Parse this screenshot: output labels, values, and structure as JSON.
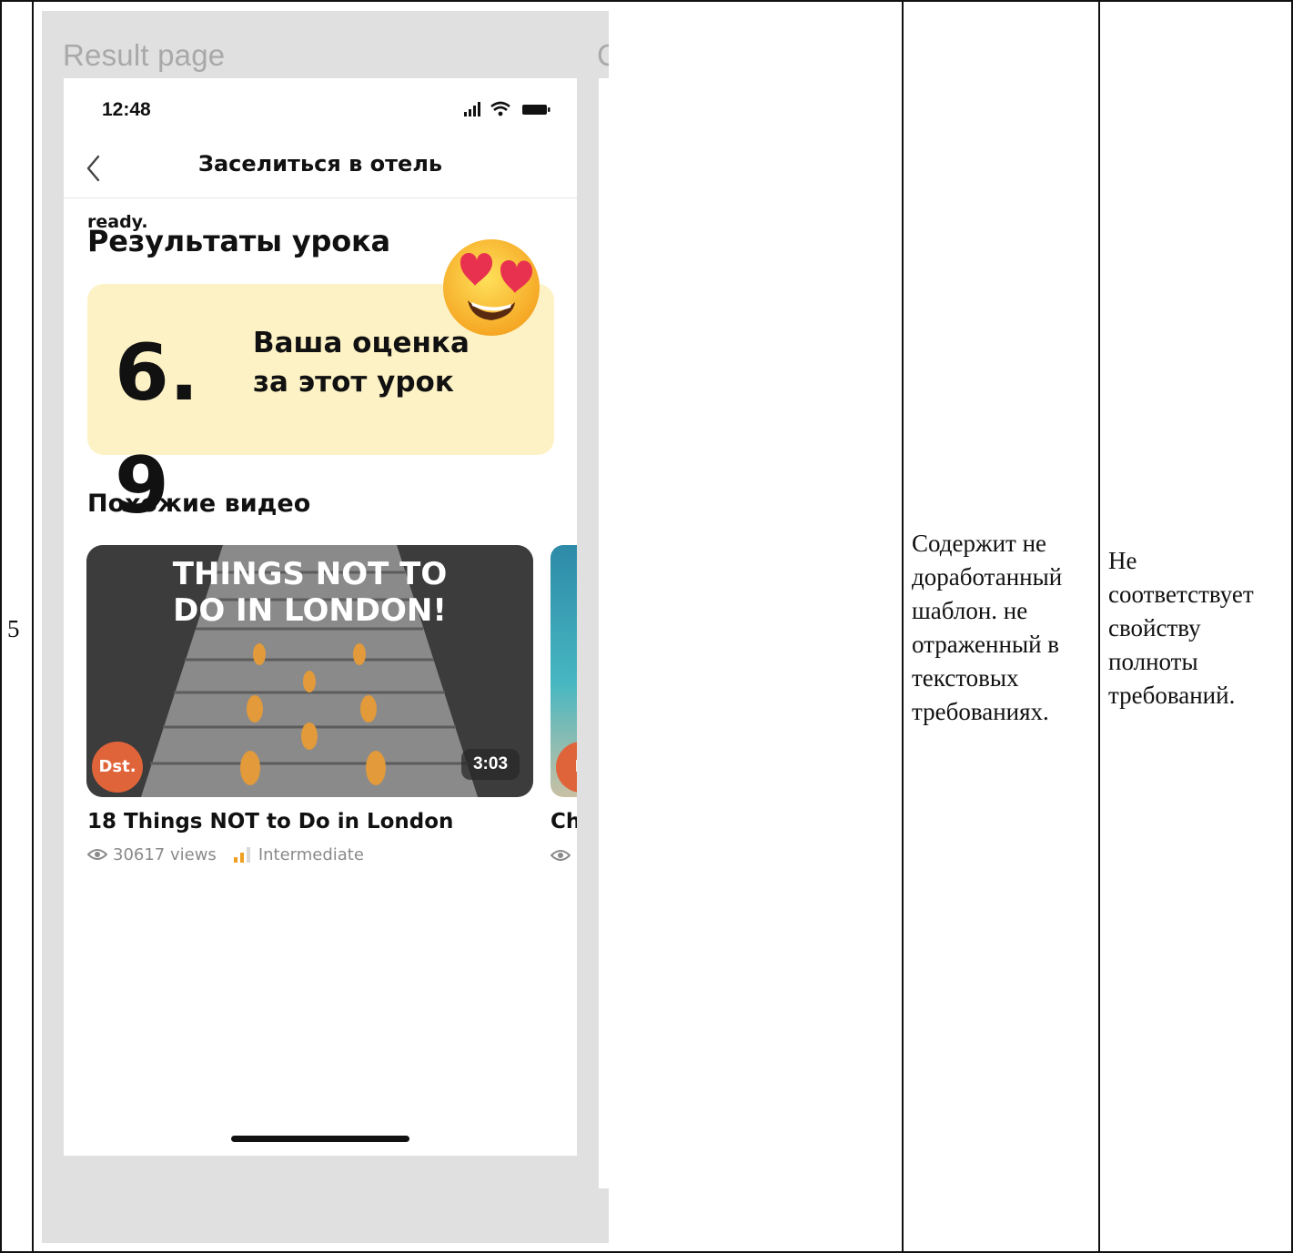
{
  "table": {
    "row_number": "5",
    "description_lines": [
      "Содержит не",
      "доработанный",
      "шаблон. не",
      "отраженный в",
      "текстовых",
      "требованиях."
    ],
    "verdict_lines": [
      "Не",
      "соответствует",
      "свойству",
      "полноты",
      "требований."
    ]
  },
  "mockup": {
    "frame_label": "Result page",
    "frame_label_next": "C",
    "status": {
      "time": "12:48"
    },
    "nav": {
      "title": "Заселиться в отель"
    },
    "overlay_text": "ready.",
    "results_heading": "Результаты урока",
    "score": {
      "value": "6.\n9",
      "label_lines": [
        "Ваша оценка",
        "за этот урок"
      ]
    },
    "similar_heading": "Похожие видео",
    "videos": [
      {
        "thumb_title_lines": [
          "THINGS NOT TO",
          "DO IN LONDON!"
        ],
        "channel_badge": "Dst.",
        "duration": "3:03",
        "title": "18 Things NOT to Do in London",
        "views": "30617 views",
        "level": "Intermediate"
      },
      {
        "channel_badge": "D",
        "title": "Ch"
      }
    ],
    "colors": {
      "score_card": "#fdf2c5",
      "badge": "#e0643a",
      "level_icon": "#f0a020"
    }
  }
}
